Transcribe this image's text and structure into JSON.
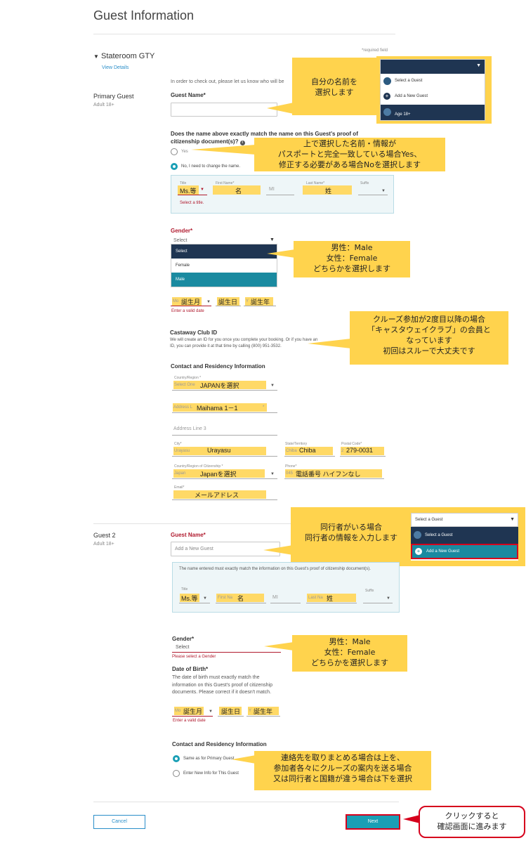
{
  "page": {
    "title": "Guest Information",
    "required_note": "*required field",
    "intro": "In order to check out, please let us know who will be"
  },
  "stateroom": {
    "label": "Stateroom GTY",
    "view_details": "View Details"
  },
  "primary": {
    "section_label": "Primary Guest",
    "section_sub": "Adult 18+",
    "guest_name_label": "Guest Name*",
    "dropdown": {
      "select_a_guest": "Select a Guest",
      "add_new": "Add a New Guest",
      "age": "Age 18+"
    },
    "callout_name": "自分の名前を\n選択します",
    "match_question": "Does the name above exactly match the name on this Guest's proof of citizenship document(s)?",
    "yes_label": "Yes",
    "no_label": "No, I need to change the name.",
    "callout_match": "上で選択した名前・情報が\nパスポートと完全一致している場合Yes、\n修正する必要がある場合Noを選択します",
    "name_fields": {
      "title_label": "Title",
      "title_value": "Ms.等",
      "first_label": "First Name*",
      "first_value": "名",
      "mi_label": "MI",
      "last_label": "Last Name*",
      "last_value": "姓",
      "suffix_label": "Suffix",
      "error": "Select a title."
    },
    "gender_label": "Gender*",
    "gender_placeholder": "Select",
    "gender_options": [
      "Select",
      "Female",
      "Male"
    ],
    "callout_gender": "男性：Male\n女性：Female\nどちらかを選択します",
    "dob": {
      "month_prefix": "Mo",
      "month": "誕生月",
      "day": "誕生日",
      "year_prefix": "Y",
      "year": "誕生年",
      "error": "Enter a valid date"
    },
    "castaway_label": "Castaway Club ID",
    "castaway_text": "We will create an ID for you once you complete your booking. Or if you have an ID, you can provide it at that time by calling (800) 951-3532.",
    "callout_castaway": "クルーズ参加が2度目以降の場合\n「キャスタウェイクラブ」の会員と\nなっています\n初回はスルーで大丈夫です",
    "contact_heading": "Contact and Residency Information",
    "country_label": "Country/Region *",
    "country_prefix": "Select One",
    "country_value": "JAPANを選択",
    "address1_prefix": "Address L",
    "address1_value": "Maihama 1－1",
    "address1_suffix": "*",
    "address3_placeholder": "Address Line 3",
    "city_label": "City*",
    "city_prefix": "Urayasu",
    "city_value": "Urayasu",
    "state_label": "State/Territory",
    "state_prefix": "Chiba",
    "state_value": "Chiba",
    "postal_label": "Postal Code*",
    "postal_prefix": "2",
    "postal_value": "279-0031",
    "citizenship_label": "Country/Region of Citizenship *",
    "citizenship_prefix": "Japan",
    "citizenship_value": "Japanを選択",
    "phone_label": "Phone*",
    "phone_prefix": "045",
    "phone_value": "電話番号 ハイフンなし",
    "email_label": "Email*",
    "email_value": "メールアドレス"
  },
  "guest2": {
    "section_label": "Guest 2",
    "section_sub": "Adult 18+",
    "guest_name_label": "Guest Name*",
    "guest_name_placeholder": "Add a New Guest",
    "callout_companion": "同行者がいる場合\n同行者の情報を入力します",
    "dropdown": {
      "header": "Select a Guest",
      "select_a_guest": "Select a Guest",
      "add_new": "Add a New Guest"
    },
    "panel_text": "The name entered must exactly match the information on this Guest's proof of citizenship document(s).",
    "name_fields": {
      "title_label": "Title",
      "title_value": "Ms.等",
      "first_prefix": "First Na",
      "first_value": "名",
      "mi_label": "MI",
      "last_prefix": "Last Na",
      "last_value": "姓",
      "suffix_label": "Suffix"
    },
    "gender_label": "Gender*",
    "gender_placeholder": "Select",
    "gender_error": "Please select a Gender",
    "callout_gender": "男性：Male\n女性：Female\nどちらかを選択します",
    "dob_label": "Date of Birth*",
    "dob_text": "The date of birth must exactly match the information on this Guest's proof of citizenship documents. Please correct if it doesn't match.",
    "dob": {
      "month_prefix": "Mo",
      "month": "誕生月",
      "day": "誕生日",
      "year_prefix": "Y",
      "year": "誕生年",
      "error": "Enter a valid date"
    },
    "contact_heading": "Contact and Residency Information",
    "same_as_primary": "Same as for Primary Guest",
    "enter_new": "Enter New Info for This Guest",
    "callout_contact": "連絡先を取りまとめる場合は上を、\n参加者各々にクルーズの案内を送る場合\n又は同行者と国籍が違う場合は下を選択"
  },
  "footer": {
    "cancel": "Cancel",
    "next": "Next",
    "callout_next": "クリックすると\n確認画面に進みます"
  }
}
